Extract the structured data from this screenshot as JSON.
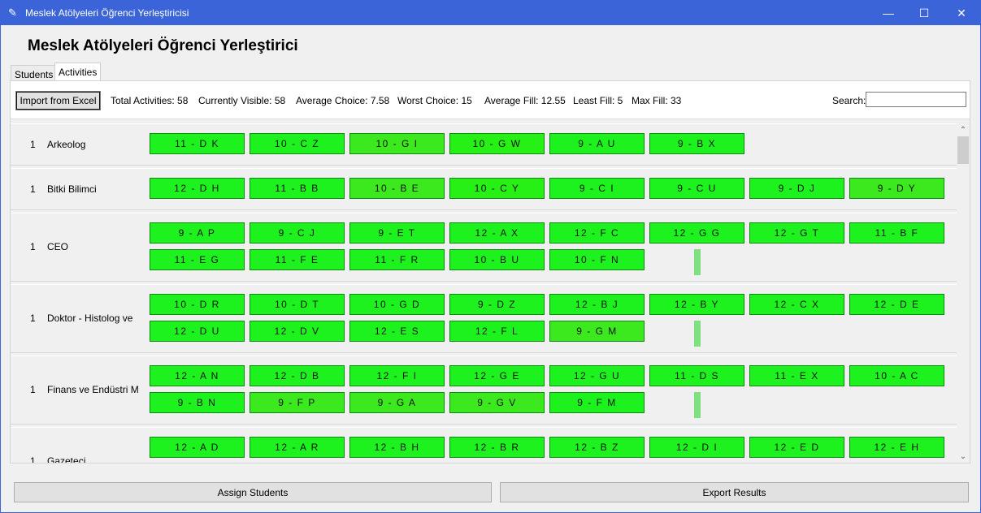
{
  "window": {
    "title": "Meslek Atölyeleri Öğrenci Yerleştiricisi",
    "minimize_glyph": "—",
    "maximize_glyph": "☐",
    "close_glyph": "✕",
    "app_icon": "feather-icon"
  },
  "heading": "Meslek Atölyeleri Öğrenci Yerleştirici",
  "tabs": [
    {
      "label": "Students",
      "active": false
    },
    {
      "label": "Activities",
      "active": true
    }
  ],
  "toolbar": {
    "import_label": "Import from Excel",
    "stats": [
      "Total Activities: 58",
      "Currently Visible: 58",
      "Average Choice: 7.58",
      "Worst Choice: 15",
      "Average Fill: 12.55",
      "Least Fill: 5",
      "Max Fill: 33"
    ],
    "search_label": "Search:",
    "search_value": ""
  },
  "colors": {
    "full": "#1ef21e",
    "filling": "#26f016",
    "near": "#3ce81e",
    "border": "#0b8a0b",
    "marker": "#7ee07e"
  },
  "activities": [
    {
      "num": "1",
      "name": "Arkeolog",
      "slots": [
        {
          "label": "11 - D K",
          "shade": "full"
        },
        {
          "label": "10 - C Z",
          "shade": "full"
        },
        {
          "label": "10 - G I",
          "shade": "near"
        },
        {
          "label": "10 - G W",
          "shade": "filling"
        },
        {
          "label": "9 - A U",
          "shade": "full"
        },
        {
          "label": "9 - B X",
          "shade": "full"
        }
      ],
      "marker": false
    },
    {
      "num": "1",
      "name": "Bitki Bilimci",
      "slots": [
        {
          "label": "12 - D H",
          "shade": "full"
        },
        {
          "label": "11 - B B",
          "shade": "full"
        },
        {
          "label": "10 - B E",
          "shade": "near"
        },
        {
          "label": "10 - C Y",
          "shade": "filling"
        },
        {
          "label": "9 - C I",
          "shade": "full"
        },
        {
          "label": "9 - C U",
          "shade": "full"
        },
        {
          "label": "9 - D J",
          "shade": "full"
        },
        {
          "label": "9 - D Y",
          "shade": "near"
        }
      ],
      "marker": false
    },
    {
      "num": "1",
      "name": "CEO",
      "slots": [
        {
          "label": "9 - A P",
          "shade": "full"
        },
        {
          "label": "9 - C J",
          "shade": "full"
        },
        {
          "label": "9 - E T",
          "shade": "full"
        },
        {
          "label": "12 - A X",
          "shade": "full"
        },
        {
          "label": "12 - F C",
          "shade": "full"
        },
        {
          "label": "12 - G G",
          "shade": "full"
        },
        {
          "label": "12 - G T",
          "shade": "full"
        },
        {
          "label": "11 - B F",
          "shade": "full"
        },
        {
          "label": "11 - E G",
          "shade": "full"
        },
        {
          "label": "11 - F E",
          "shade": "full"
        },
        {
          "label": "11 - F R",
          "shade": "full"
        },
        {
          "label": "10 - B U",
          "shade": "full"
        },
        {
          "label": "10 - F N",
          "shade": "full"
        }
      ],
      "marker": true
    },
    {
      "num": "1",
      "name": "Doktor - Histolog ve",
      "slots": [
        {
          "label": "10 - D R",
          "shade": "full"
        },
        {
          "label": "10 - D T",
          "shade": "full"
        },
        {
          "label": "10 - G D",
          "shade": "full"
        },
        {
          "label": "9 - D Z",
          "shade": "full"
        },
        {
          "label": "12 - B J",
          "shade": "full"
        },
        {
          "label": "12 - B Y",
          "shade": "full"
        },
        {
          "label": "12 - C X",
          "shade": "full"
        },
        {
          "label": "12 - D E",
          "shade": "full"
        },
        {
          "label": "12 - D U",
          "shade": "full"
        },
        {
          "label": "12 - D V",
          "shade": "full"
        },
        {
          "label": "12 - E S",
          "shade": "full"
        },
        {
          "label": "12 - F L",
          "shade": "full"
        },
        {
          "label": "9 - G M",
          "shade": "near"
        }
      ],
      "marker": true
    },
    {
      "num": "1",
      "name": "Finans ve Endüstri M",
      "slots": [
        {
          "label": "12 - A N",
          "shade": "full"
        },
        {
          "label": "12 - D B",
          "shade": "full"
        },
        {
          "label": "12 - F I",
          "shade": "full"
        },
        {
          "label": "12 - G E",
          "shade": "full"
        },
        {
          "label": "12 - G U",
          "shade": "full"
        },
        {
          "label": "11 - D S",
          "shade": "full"
        },
        {
          "label": "11 - E X",
          "shade": "full"
        },
        {
          "label": "10 - A C",
          "shade": "full"
        },
        {
          "label": "9 - B N",
          "shade": "full"
        },
        {
          "label": "9 - F P",
          "shade": "near"
        },
        {
          "label": "9 - G A",
          "shade": "near"
        },
        {
          "label": "9 - G V",
          "shade": "near"
        },
        {
          "label": "9 - F M",
          "shade": "full"
        }
      ],
      "marker": true
    },
    {
      "num": "1",
      "name": "Gazeteci",
      "slots": [
        {
          "label": "12 - A D",
          "shade": "full"
        },
        {
          "label": "12 - A R",
          "shade": "full"
        },
        {
          "label": "12 - B H",
          "shade": "full"
        },
        {
          "label": "12 - B R",
          "shade": "full"
        },
        {
          "label": "12 - B Z",
          "shade": "full"
        },
        {
          "label": "12 - D I",
          "shade": "full"
        },
        {
          "label": "12 - E D",
          "shade": "full"
        },
        {
          "label": "12 - E H",
          "shade": "full"
        }
      ],
      "marker": false
    }
  ],
  "buttons": {
    "assign": "Assign Students",
    "export": "Export Results"
  },
  "scrollbar": {
    "up": "⌃",
    "down": "⌄"
  }
}
